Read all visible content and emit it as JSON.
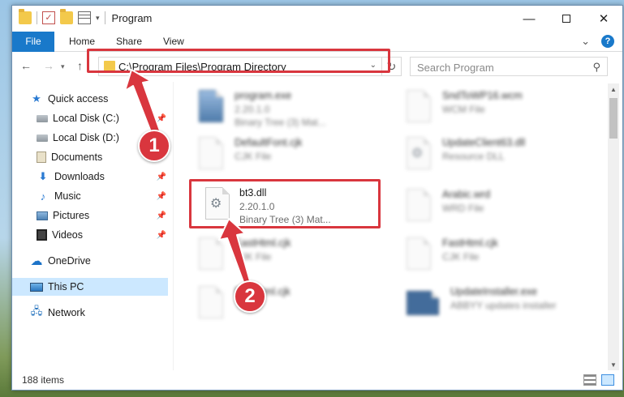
{
  "titlebar": {
    "title": "Program",
    "minimize_icon": "minimize-icon",
    "maximize_icon": "maximize-icon",
    "close_icon": "close-icon",
    "close_glyph": "✕",
    "min_glyph": "—"
  },
  "ribbon": {
    "tabs": [
      "File",
      "Home",
      "Share",
      "View"
    ]
  },
  "navbar": {
    "address": "C:\\Program Files\\Program Directory",
    "search_placeholder": "Search Program"
  },
  "sidebar": {
    "items": [
      {
        "label": "Quick access",
        "icon": "star-icon",
        "pinned": false
      },
      {
        "label": "Local Disk (C:)",
        "icon": "disk-icon",
        "pinned": true
      },
      {
        "label": "Local Disk (D:)",
        "icon": "disk-icon",
        "pinned": true
      },
      {
        "label": "Documents",
        "icon": "documents-icon",
        "pinned": true
      },
      {
        "label": "Downloads",
        "icon": "downloads-icon",
        "pinned": true
      },
      {
        "label": "Music",
        "icon": "music-icon",
        "pinned": true
      },
      {
        "label": "Pictures",
        "icon": "pictures-icon",
        "pinned": true
      },
      {
        "label": "Videos",
        "icon": "videos-icon",
        "pinned": true
      },
      {
        "label": "OneDrive",
        "icon": "onedrive-icon",
        "pinned": false
      },
      {
        "label": "This PC",
        "icon": "pc-icon",
        "pinned": false,
        "selected": true
      },
      {
        "label": "Network",
        "icon": "network-icon",
        "pinned": false
      }
    ]
  },
  "files": [
    {
      "name": "program.exe",
      "version": "2.20.1.0",
      "desc": "Binary Tree (3) Mat...",
      "icon": "exe-icon",
      "blurred": true
    },
    {
      "name": "SndToWP16.wcm",
      "version": "WCM File",
      "desc": "",
      "icon": "file-icon",
      "blurred": true
    },
    {
      "name": "DefaultFont.cjk",
      "version": "CJK File",
      "desc": "",
      "icon": "file-icon",
      "blurred": true
    },
    {
      "name": "UpdateClient63.dll",
      "version": "Resource DLL",
      "desc": "",
      "icon": "dll-icon",
      "blurred": true
    },
    {
      "name": "bt3.dll",
      "version": "2.20.1.0",
      "desc": "Binary Tree (3) Mat...",
      "icon": "dll-icon",
      "blurred": false
    },
    {
      "name": "Arabic.wrd",
      "version": "WRD File",
      "desc": "",
      "icon": "file-icon",
      "blurred": true
    },
    {
      "name": "EastHtml.cjk",
      "version": "CJK File",
      "desc": "",
      "icon": "file-icon",
      "blurred": true
    },
    {
      "name": "FastHtml.cjk",
      "version": "CJK File",
      "desc": "",
      "icon": "file-icon",
      "blurred": true
    },
    {
      "name": "FastHtml.cjk",
      "version": "",
      "desc": "",
      "icon": "file-icon",
      "blurred": true
    },
    {
      "name": "UpdateInstaller.exe",
      "version": "ABBYY updates installer",
      "desc": "",
      "icon": "installer-icon",
      "blurred": true
    }
  ],
  "status": {
    "item_count": "188 items"
  },
  "annotations": {
    "step1": "1",
    "step2": "2",
    "accent_color": "#d9363e"
  },
  "colors": {
    "file_tab": "#1979ca",
    "selected": "#cce8ff"
  }
}
